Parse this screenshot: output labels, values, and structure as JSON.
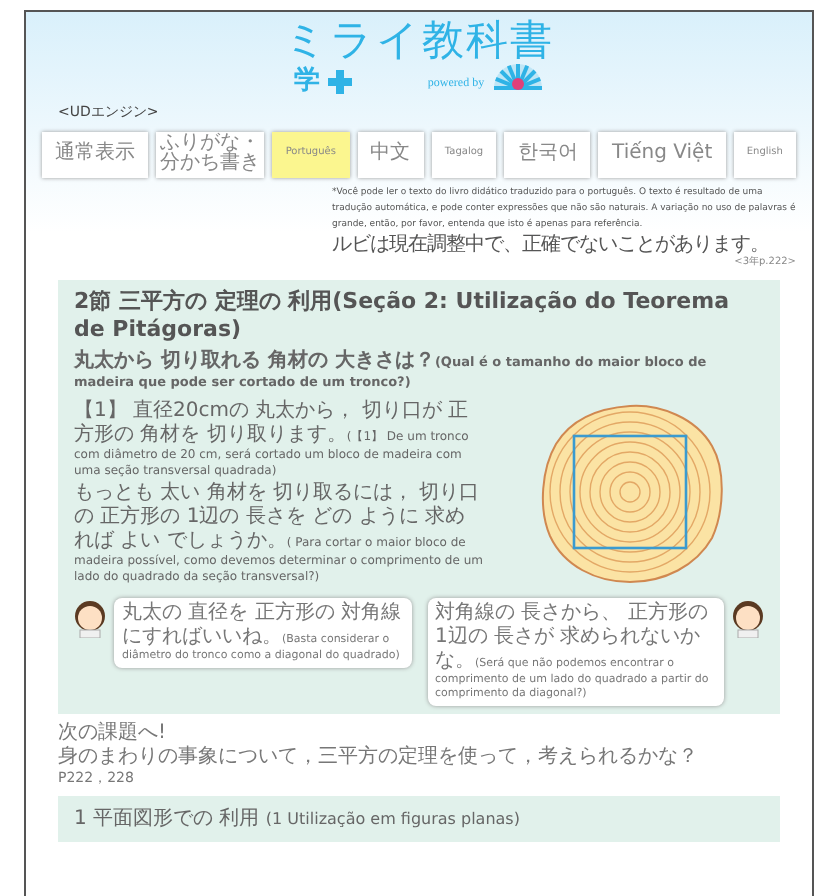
{
  "header": {
    "logo_title": "ミライ教科書",
    "logo_sub": "学",
    "powered_by": "powered by"
  },
  "ud_label": "<UDエンジン>",
  "modes": [
    {
      "label": "通常表示",
      "selected": false
    },
    {
      "label": "ふりがな・分かち書き",
      "selected": false
    },
    {
      "label": "Português",
      "selected": true
    },
    {
      "label": "中文",
      "selected": false
    },
    {
      "label": "Tagalog",
      "selected": false
    },
    {
      "label": "한국어",
      "selected": false
    },
    {
      "label": "Tiếng Việt",
      "selected": false
    },
    {
      "label": "English",
      "selected": false
    }
  ],
  "notice": [
    "*Você pode ler o texto do livro didático traduzido para o português. O texto é resultado de uma tradução automática, e pode conter expressões que não são naturais. A variação no uso de palavras é grande, então, por favor, entenda que isto é apenas para referência.",
    "ルビは現在調整中で、正確でないことがあります。"
  ],
  "page_ref": "<3年p.222>",
  "section": {
    "title_ja": "2節 三平方の 定理の 利用",
    "title_pt": "(Seção 2: Utilização do Teorema de Pitágoras)",
    "question_ja": "丸太から 切り取れる 角材の 大きさは？",
    "question_pt": "(Qual é o tamanho do maior bloco de madeira que pode ser cortado de um tronco?)",
    "paragraphs": [
      {
        "ja": "【1】 直径20cmの 丸太から， 切り口が 正方形の 角材を 切り取ります。",
        "pt": "(【1】 De um tronco com diâmetro de 20 cm, será cortado um bloco de madeira com uma seção transversal quadrada)"
      },
      {
        "ja": "もっとも 太い 角材を 切り取るには， 切り口の 正方形の 1辺の 長さを どの ように 求めれば よい でしょうか。",
        "pt": "( Para cortar o maior bloco de madeira possível, como devemos determinar o comprimento de um lado do quadrado da seção transversal?)"
      }
    ],
    "bubbles": [
      {
        "kind": "left",
        "ja": "丸太の 直径を 正方形の 対角線にすればいいね。",
        "pt": "(Basta considerar o diâmetro do tronco como a diagonal do quadrado)"
      },
      {
        "kind": "right",
        "ja": "対角線の 長さから、 正方形の 1辺の 長さが 求められないかな。",
        "pt": "(Será que não podemos encontrar o comprimento de um lado do quadrado a partir do comprimento da diagonal?)"
      }
    ]
  },
  "next": {
    "heading": "次の課題へ!",
    "text": "身のまわりの事象について，三平方の定理を使って，考えられるかな？",
    "pages": "P222，228"
  },
  "next_section": {
    "title_ja": "1 平面図形での 利用",
    "title_pt": "(1 Utilização em figuras planas)"
  }
}
